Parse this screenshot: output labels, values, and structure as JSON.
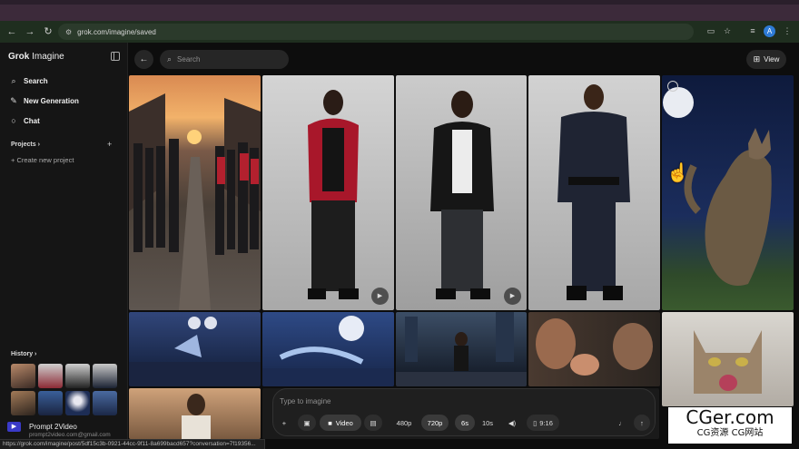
{
  "browser": {
    "url": "grok.com/imagine/saved",
    "status_url": "https://grok.com/imagine/post/5df15c3b-0921-44cc-9f11-8a699bacd657?conversation=7f19356...",
    "avatar_letter": "A",
    "icons": [
      "back-arrow-icon",
      "forward-arrow-icon",
      "reload-icon",
      "site-settings-icon",
      "cast-icon",
      "star-icon",
      "extensions-icon",
      "menu-icon"
    ]
  },
  "sidebar": {
    "brand_bold": "Grok",
    "brand_rest": " Imagine",
    "items": [
      {
        "label": "Search",
        "icon": "search-icon"
      },
      {
        "label": "New Generation",
        "icon": "edit-icon"
      },
      {
        "label": "Chat",
        "icon": "chat-icon"
      }
    ],
    "projects_label": "Projects ›",
    "create_project": "+ Create new project",
    "history_label": "History ›",
    "prompt_title": "Prompt 2Video",
    "prompt_sub": "prompt2video.com@gmail.com",
    "prompt_icon": "▶"
  },
  "header": {
    "search_placeholder": "Search",
    "view_label": "View"
  },
  "composer": {
    "placeholder": "Type to imagine",
    "add": "+",
    "video_label": "Video",
    "res_480": "480p",
    "res_720": "720p",
    "dur_6": "6s",
    "dur_10": "10s",
    "aspect": "9:16"
  },
  "colors": {
    "accent": "#2e7bd6",
    "panel": "#1f1f1f",
    "background": "#0d0d0d"
  },
  "watermark": {
    "main": "CGer.com",
    "sub": "CG资源 CG网站"
  }
}
